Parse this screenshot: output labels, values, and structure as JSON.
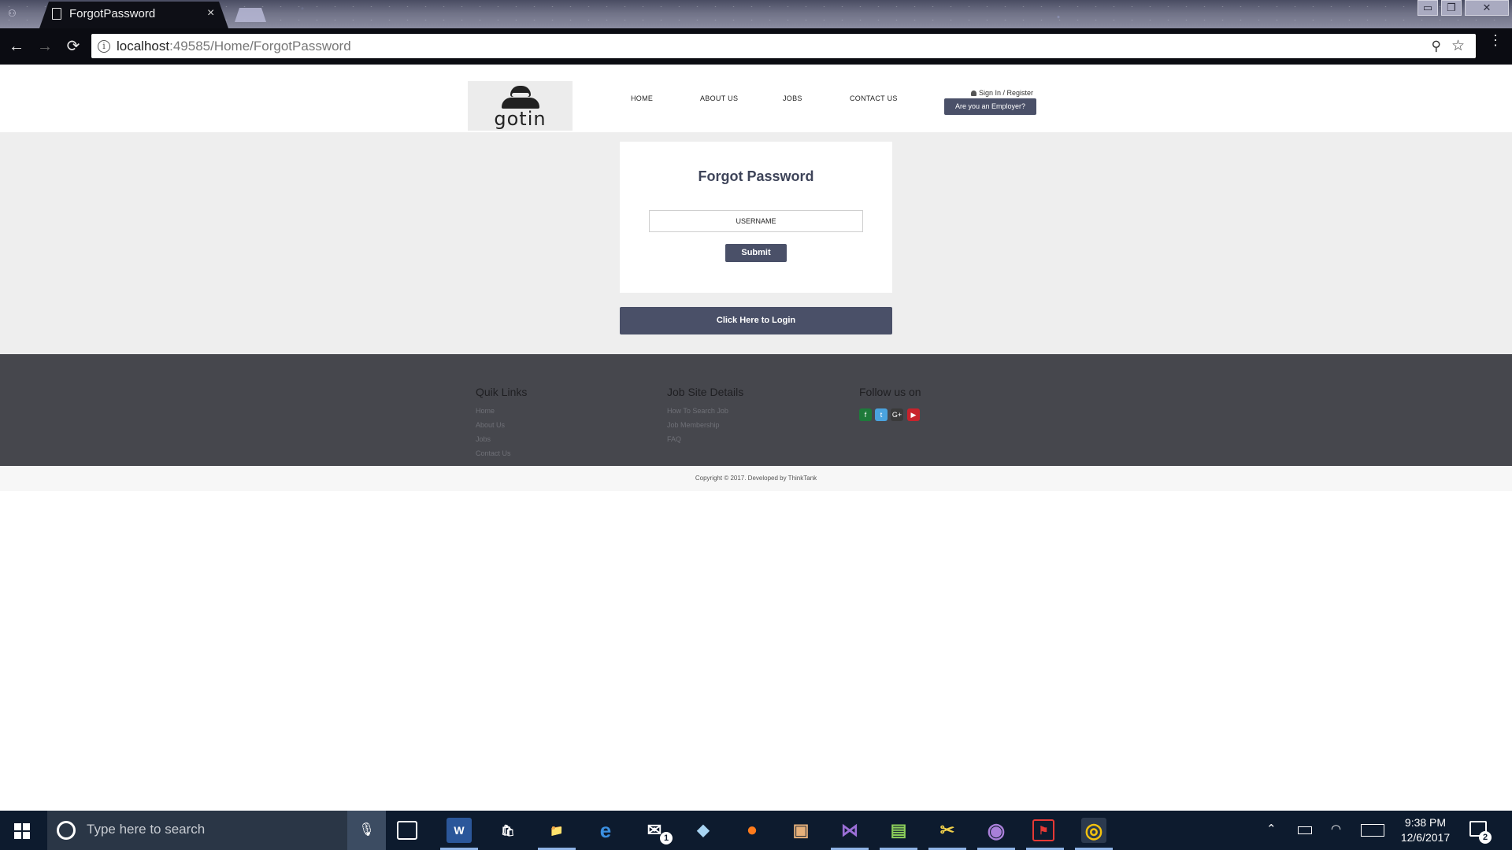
{
  "browser": {
    "tab_title": "ForgotPassword",
    "tab_close": "×",
    "url_host": "localhost",
    "url_rest": ":49585/Home/ForgotPassword",
    "back_icon": "←",
    "forward_icon": "→",
    "reload_icon": "⟳",
    "info_icon": "i",
    "zoom_icon": "⚲",
    "star_icon": "☆",
    "menu_icon": "⋮",
    "window_controls": [
      "▭",
      "❐",
      "✕"
    ]
  },
  "header": {
    "logo_text": "gotin",
    "nav": [
      "HOME",
      "ABOUT US",
      "JOBS",
      "CONTACT US"
    ],
    "signin_label": "Sign In / Register",
    "employer_button": "Are you an Employer?"
  },
  "form": {
    "title": "Forgot Password",
    "username_placeholder": "USERNAME",
    "submit_label": "Submit",
    "login_label": "Click Here to Login"
  },
  "footer": {
    "col1_title": "Quik Links",
    "col1_links": [
      "Home",
      "About Us",
      "Jobs",
      "Contact Us"
    ],
    "col2_title": "Job Site Details",
    "col2_links": [
      "How To Search Job",
      "Job Membership",
      "FAQ"
    ],
    "col3_title": "Follow us on",
    "social": [
      {
        "name": "facebook",
        "glyph": "f",
        "color": "#1e7a3a"
      },
      {
        "name": "twitter",
        "glyph": "t",
        "color": "#4aa3df"
      },
      {
        "name": "google-plus",
        "glyph": "G+",
        "color": "#3a3a3a"
      },
      {
        "name": "youtube",
        "glyph": "▶",
        "color": "#c8232c"
      }
    ]
  },
  "copyright": "Copyright © 2017. Developed by ThinkTank",
  "taskbar": {
    "search_placeholder": "Type here to search",
    "mic_icon": "🎙",
    "apps": [
      {
        "name": "word",
        "glyph": "W",
        "color": "#2b579a"
      },
      {
        "name": "store",
        "glyph": "🛍",
        "color": "#0d1b2e"
      },
      {
        "name": "file-explorer",
        "glyph": "📁",
        "color": "#0d1b2e"
      },
      {
        "name": "edge",
        "glyph": "e",
        "color": "#0d1b2e"
      },
      {
        "name": "mail",
        "glyph": "✉",
        "color": "#0d1b2e"
      },
      {
        "name": "app-blue",
        "glyph": "◆",
        "color": "#0d1b2e"
      },
      {
        "name": "firefox",
        "glyph": "●",
        "color": "#0d1b2e"
      },
      {
        "name": "app-box",
        "glyph": "▣",
        "color": "#0d1b2e"
      },
      {
        "name": "visual-studio",
        "glyph": "⋈",
        "color": "#0d1b2e"
      },
      {
        "name": "app-green",
        "glyph": "▤",
        "color": "#0d1b2e"
      },
      {
        "name": "tools",
        "glyph": "✂",
        "color": "#0d1b2e"
      },
      {
        "name": "github",
        "glyph": "◉",
        "color": "#0d1b2e"
      },
      {
        "name": "acrobat",
        "glyph": "⚑",
        "color": "#0d1b2e"
      },
      {
        "name": "chrome",
        "glyph": "◎",
        "color": "#0d1b2e"
      }
    ],
    "mail_badge": "1",
    "time": "9:38 PM",
    "date": "12/6/2017",
    "notification_count": "2"
  }
}
